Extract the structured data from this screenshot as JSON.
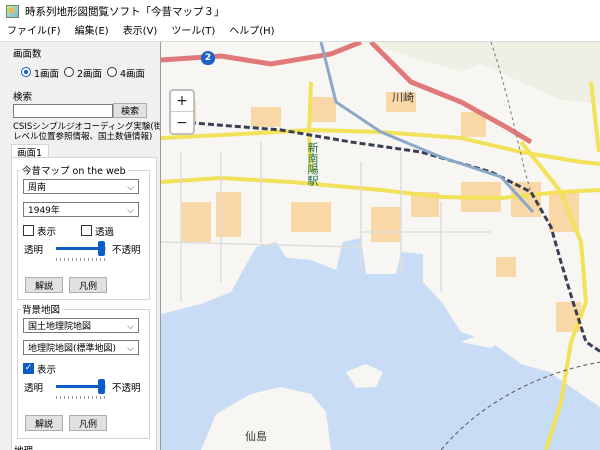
{
  "window": {
    "title": "時系列地形図閲覧ソフト「今昔マップ３」"
  },
  "menu": [
    "ファイル(F)",
    "編集(E)",
    "表示(V)",
    "ツール(T)",
    "ヘルプ(H)"
  ],
  "screen_count": {
    "label": "画面数",
    "options": [
      "1画面",
      "2画面",
      "4画面"
    ],
    "selected": "1画面"
  },
  "search": {
    "label": "検索",
    "value": "",
    "button": "検索",
    "note_line1": "CSISシンプルジオコーディング実験(街区",
    "note_line2": "レベル位置参照情報、国土数値情報)"
  },
  "screen1": {
    "tab_label": "画面1",
    "konjaku": {
      "label": "今昔マップ on the web",
      "region": "周南",
      "year": "1949年",
      "show_label": "表示",
      "show_checked": false,
      "transparent_label": "透過",
      "transparent_checked": false,
      "transparent_text": "透明",
      "opaque_text": "不透明",
      "opacity": 0.9,
      "legend_button": "解説",
      "hanrei_button": "凡例"
    },
    "background": {
      "label": "背景地図",
      "source": "国土地理院地図",
      "map_type": "地理院地図(標準地図)",
      "show_label": "表示",
      "show_checked": true,
      "transparent_text": "透明",
      "opaque_text": "不透明",
      "opacity": 0.9,
      "legend_button": "解説",
      "hanrei_button": "凡例"
    },
    "next_section_partial": "地理"
  },
  "map": {
    "zoom_in": "+",
    "zoom_out": "−",
    "route_shield": "2",
    "labels": {
      "kawasaki": "川崎",
      "station": "新南陽駅",
      "sento": "仙島"
    },
    "colors": {
      "sea": "#c9dcf5",
      "land": "#f7f6f2",
      "building": "#f9d7a6",
      "main_road": "#f1e25a",
      "national_road": "#e07a7a",
      "rail": "#3a3f55",
      "shinkansen": "#8ca8c8"
    }
  }
}
